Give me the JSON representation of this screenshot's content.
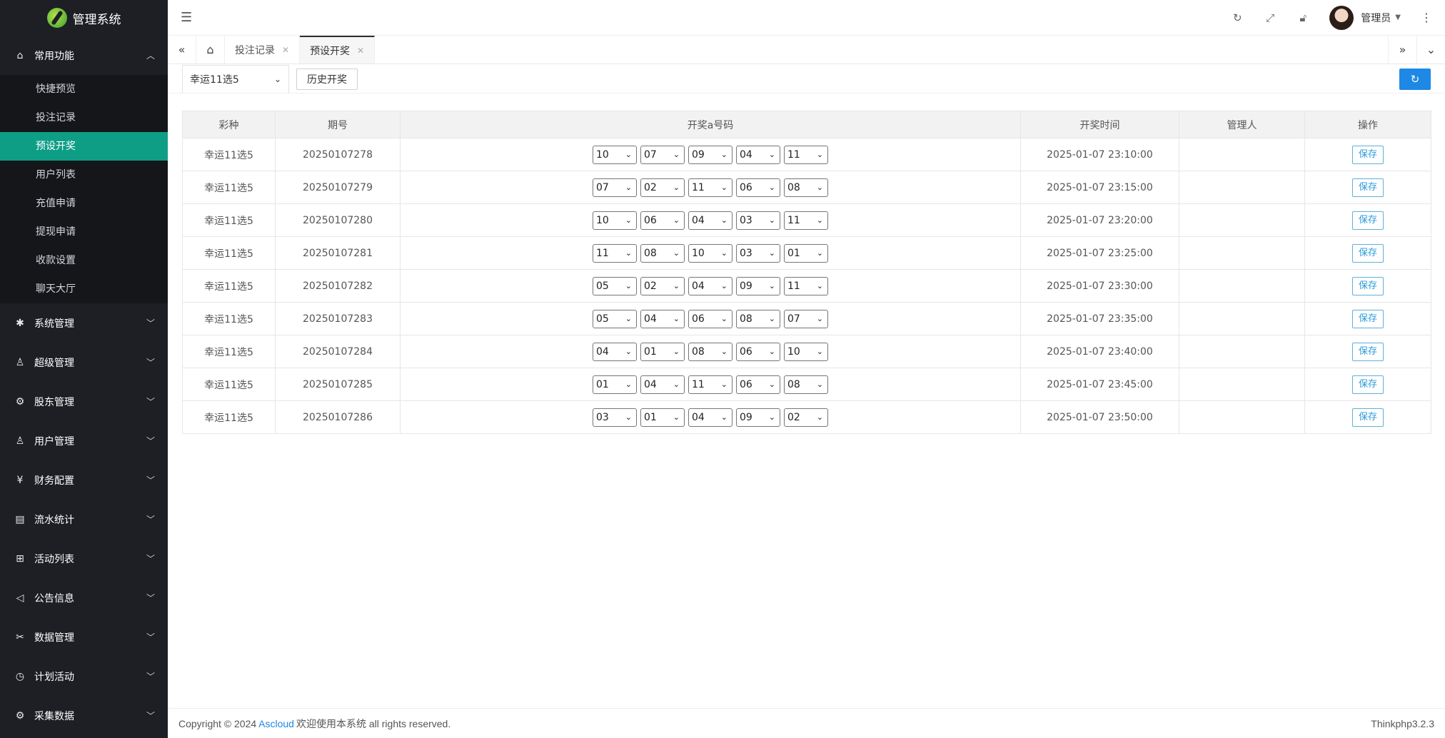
{
  "app": {
    "title": "管理系统"
  },
  "sidebar": {
    "open_group": {
      "label": "常用功能",
      "icon": "home-icon"
    },
    "items": [
      "快捷预览",
      "投注记录",
      "预设开奖",
      "用户列表",
      "充值申请",
      "提现申请",
      "收款设置",
      "聊天大厅"
    ],
    "active_index": 2,
    "groups": [
      {
        "label": "系统管理",
        "icon": "gear-icon"
      },
      {
        "label": "超级管理",
        "icon": "user-icon"
      },
      {
        "label": "股东管理",
        "icon": "cog-icon"
      },
      {
        "label": "用户管理",
        "icon": "user-icon"
      },
      {
        "label": "财务配置",
        "icon": "yen-icon"
      },
      {
        "label": "流水统计",
        "icon": "doc-icon"
      },
      {
        "label": "活动列表",
        "icon": "gift-icon"
      },
      {
        "label": "公告信息",
        "icon": "speaker-icon"
      },
      {
        "label": "数据管理",
        "icon": "tools-icon"
      },
      {
        "label": "计划活动",
        "icon": "clock-icon"
      },
      {
        "label": "采集数据",
        "icon": "cog-icon"
      }
    ]
  },
  "header": {
    "username": "管理员"
  },
  "tabs": [
    {
      "label": "投注记录",
      "active": false
    },
    {
      "label": "预设开奖",
      "active": true
    }
  ],
  "toolbar": {
    "lottery_select": "幸运11选5",
    "history_button": "历史开奖"
  },
  "table": {
    "headers": [
      "彩种",
      "期号",
      "开奖a号码",
      "开奖时间",
      "管理人",
      "操作"
    ],
    "save_label": "保存",
    "rows": [
      {
        "type": "幸运11选5",
        "issue": "20250107278",
        "nums": [
          "10",
          "07",
          "09",
          "04",
          "11"
        ],
        "time": "2025-01-07 23:10:00",
        "admin": ""
      },
      {
        "type": "幸运11选5",
        "issue": "20250107279",
        "nums": [
          "07",
          "02",
          "11",
          "06",
          "08"
        ],
        "time": "2025-01-07 23:15:00",
        "admin": ""
      },
      {
        "type": "幸运11选5",
        "issue": "20250107280",
        "nums": [
          "10",
          "06",
          "04",
          "03",
          "11"
        ],
        "time": "2025-01-07 23:20:00",
        "admin": ""
      },
      {
        "type": "幸运11选5",
        "issue": "20250107281",
        "nums": [
          "11",
          "08",
          "10",
          "03",
          "01"
        ],
        "time": "2025-01-07 23:25:00",
        "admin": ""
      },
      {
        "type": "幸运11选5",
        "issue": "20250107282",
        "nums": [
          "05",
          "02",
          "04",
          "09",
          "11"
        ],
        "time": "2025-01-07 23:30:00",
        "admin": ""
      },
      {
        "type": "幸运11选5",
        "issue": "20250107283",
        "nums": [
          "05",
          "04",
          "06",
          "08",
          "07"
        ],
        "time": "2025-01-07 23:35:00",
        "admin": ""
      },
      {
        "type": "幸运11选5",
        "issue": "20250107284",
        "nums": [
          "04",
          "01",
          "08",
          "06",
          "10"
        ],
        "time": "2025-01-07 23:40:00",
        "admin": ""
      },
      {
        "type": "幸运11选5",
        "issue": "20250107285",
        "nums": [
          "01",
          "04",
          "11",
          "06",
          "08"
        ],
        "time": "2025-01-07 23:45:00",
        "admin": ""
      },
      {
        "type": "幸运11选5",
        "issue": "20250107286",
        "nums": [
          "03",
          "01",
          "04",
          "09",
          "02"
        ],
        "time": "2025-01-07 23:50:00",
        "admin": ""
      }
    ]
  },
  "footer": {
    "copyright_prefix": "Copyright © 2024",
    "brand": "Ascloud",
    "copyright_suffix": "欢迎使用本系统 all rights reserved.",
    "version": "Thinkphp3.2.3"
  },
  "colors": {
    "sidebar_bg": "#1d1f25",
    "active_item": "#0e9e86",
    "accent_blue": "#1e88e5"
  }
}
